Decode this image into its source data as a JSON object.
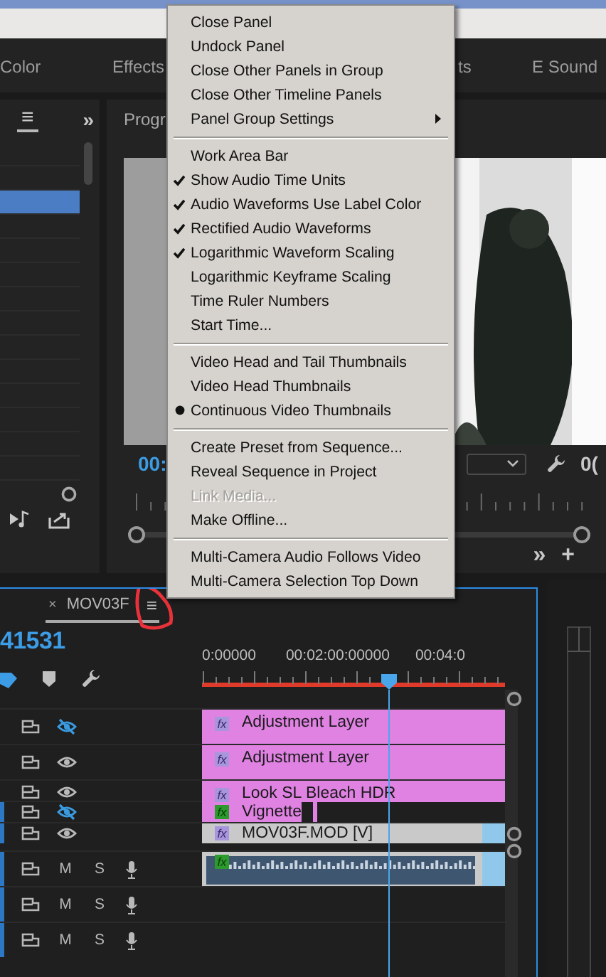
{
  "workspace_tabs": [
    {
      "label": "Color",
      "selected": false
    },
    {
      "label": "Effects",
      "selected": false
    },
    {
      "label": "ts",
      "selected": false
    },
    {
      "label": "E Sound",
      "selected": false
    }
  ],
  "project_panel": {
    "menu_icon": "≡",
    "overflow_icon": "»",
    "rows": [
      {
        "selected": false
      },
      {
        "selected": false
      },
      {
        "selected": true
      },
      {
        "selected": false
      },
      {
        "selected": false
      },
      {
        "selected": false
      },
      {
        "selected": false
      },
      {
        "selected": false
      },
      {
        "selected": false
      },
      {
        "selected": false
      },
      {
        "selected": false
      },
      {
        "selected": false
      },
      {
        "selected": false
      },
      {
        "selected": false
      }
    ]
  },
  "program_monitor": {
    "title": "Progr",
    "timecode": "00:",
    "end_timecode": "0(",
    "overflow_icon": "»",
    "add_icon": "+"
  },
  "timeline": {
    "tab": {
      "close_icon": "×",
      "label": "MOV03F",
      "menu_icon": "≡",
      "selected": true
    },
    "timecode": "41531",
    "ruler_labels": [
      "0:00000",
      "00:02:00:00000",
      "00:04:0"
    ],
    "video_tracks": [
      {
        "visible": false,
        "expanded": true,
        "targeted": false,
        "clip": {
          "kind": "adjustment",
          "badge": "fx",
          "effects_applied": false,
          "label": "Adjustment Layer"
        }
      },
      {
        "visible": true,
        "expanded": true,
        "targeted": false,
        "clip": {
          "kind": "adjustment",
          "badge": "fx",
          "effects_applied": false,
          "label": "Adjustment Layer"
        }
      },
      {
        "visible": true,
        "expanded": false,
        "targeted": false,
        "clip": {
          "kind": "adjustment",
          "badge": "fx",
          "effects_applied": false,
          "label": "Look SL Bleach HDR"
        }
      },
      {
        "visible": false,
        "expanded": false,
        "targeted": true,
        "clip": {
          "kind": "partial",
          "badge": "fx",
          "effects_applied": true,
          "label": "Vignette"
        }
      },
      {
        "visible": true,
        "expanded": false,
        "targeted": true,
        "clip": {
          "kind": "media",
          "badge": "fx",
          "effects_applied": false,
          "label": "MOV03F.MOD [V]"
        }
      }
    ],
    "audio_tracks": [
      {
        "targeted": true,
        "mute_label": "M",
        "solo_label": "S",
        "clip": {
          "kind": "audio",
          "badge": "fx",
          "effects_applied": true
        }
      },
      {
        "targeted": true,
        "mute_label": "M",
        "solo_label": "S"
      },
      {
        "targeted": true,
        "mute_label": "M",
        "solo_label": "S"
      }
    ]
  },
  "panel_menu": {
    "groups": [
      [
        {
          "kind": "command",
          "label": "Close Panel",
          "disabled": false
        },
        {
          "kind": "command",
          "label": "Undock Panel",
          "disabled": false
        },
        {
          "kind": "command",
          "label": "Close Other Panels in Group",
          "disabled": false
        },
        {
          "kind": "command",
          "label": "Close Other Timeline Panels",
          "disabled": false
        },
        {
          "kind": "submenu",
          "label": "Panel Group Settings"
        }
      ],
      [
        {
          "kind": "toggle",
          "label": "Work Area Bar",
          "checked": false
        },
        {
          "kind": "toggle",
          "label": "Show Audio Time Units",
          "checked": true
        },
        {
          "kind": "toggle",
          "label": "Audio Waveforms Use Label Color",
          "checked": true
        },
        {
          "kind": "toggle",
          "label": "Rectified Audio Waveforms",
          "checked": true
        },
        {
          "kind": "toggle",
          "label": "Logarithmic Waveform Scaling",
          "checked": true
        },
        {
          "kind": "toggle",
          "label": "Logarithmic Keyframe Scaling",
          "checked": false
        },
        {
          "kind": "toggle",
          "label": "Time Ruler Numbers",
          "checked": false
        },
        {
          "kind": "command",
          "label": "Start Time...",
          "disabled": false
        }
      ],
      [
        {
          "kind": "radio",
          "label": "Video Head and Tail Thumbnails",
          "selected": false
        },
        {
          "kind": "radio",
          "label": "Video Head Thumbnails",
          "selected": false
        },
        {
          "kind": "radio",
          "label": "Continuous Video Thumbnails",
          "selected": true
        }
      ],
      [
        {
          "kind": "command",
          "label": "Create Preset from Sequence...",
          "disabled": false
        },
        {
          "kind": "command",
          "label": "Reveal Sequence in Project",
          "disabled": false
        },
        {
          "kind": "command",
          "label": "Link Media...",
          "disabled": true
        },
        {
          "kind": "command",
          "label": "Make Offline...",
          "disabled": false
        }
      ],
      [
        {
          "kind": "toggle",
          "label": "Multi-Camera Audio Follows Video",
          "checked": false
        },
        {
          "kind": "toggle",
          "label": "Multi-Camera Selection Top Down",
          "checked": false
        }
      ]
    ]
  }
}
